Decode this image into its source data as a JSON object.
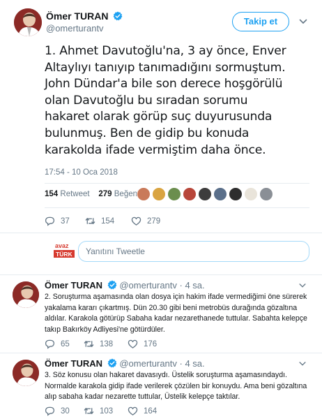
{
  "main_tweet": {
    "author": "Ömer TURAN",
    "handle": "@omerturantv",
    "follow_label": "Takip et",
    "text_lines": [
      "1. Ahmet Davutoğlu'na, 3 ay önce, Enver",
      "Altaylıyı tanıyıp tanımadığını sormuştum.",
      "John Dündar'a bile son derece hoşgörülü",
      "olan Davutoğlu bu sıradan sorumu",
      "hakaret olarak görüp suç duyurusunda",
      "bulunmuş. Ben de gidip bu konuda",
      "karakolda ifade vermiştim daha önce."
    ],
    "timestamp": "17:54 - 10 Oca 2018",
    "retweet_count": "154",
    "retweet_label": "Retweet",
    "like_count": "279",
    "like_label": "Beğeni",
    "actions": {
      "replies": "37",
      "retweets": "154",
      "likes": "279"
    }
  },
  "reply_box": {
    "placeholder": "Yanıtını Tweetle",
    "logo_text_top": "avaz",
    "logo_text_bottom": "TÜRK"
  },
  "replies": [
    {
      "author": "Ömer TURAN",
      "handle": "@omerturantv",
      "time": "· 4 sa.",
      "text_lines": [
        "2. Soruşturma aşamasında olan dosya için hakim ifade vermediğimi öne sürerek",
        "yakalama kararı çıkartmış. Dün 20.30 gibi beni metrobüs durağında gözaltına",
        "aldılar. Karakola götürüp Sabaha kadar nezarethanede tuttular. Sabahta kelepçe",
        "takıp Bakırköy Adliyesi'ne götürdüler."
      ],
      "actions": {
        "replies": "65",
        "retweets": "138",
        "likes": "176"
      }
    },
    {
      "author": "Ömer TURAN",
      "handle": "@omerturantv",
      "time": "· 4 sa.",
      "text_lines": [
        "3. Söz konusu olan hakaret davasıydı. Üstelik soruşturma aşamasındaydı.",
        "Normalde karakola gidip ifade verilerek çözülen bir konuydu. Ama beni gözaltına",
        "alıp sabaha kadar nezarette tuttular, Üstelik kelepçe taktılar."
      ],
      "actions": {
        "replies": "30",
        "retweets": "103",
        "likes": "164"
      }
    }
  ],
  "colors": {
    "accent": "#1da1f2",
    "text": "#14171a",
    "muted": "#657786",
    "divider": "#e6ecf0"
  },
  "icons": [
    "verified-icon",
    "chevron-down-icon",
    "reply-icon",
    "retweet-icon",
    "like-icon"
  ]
}
